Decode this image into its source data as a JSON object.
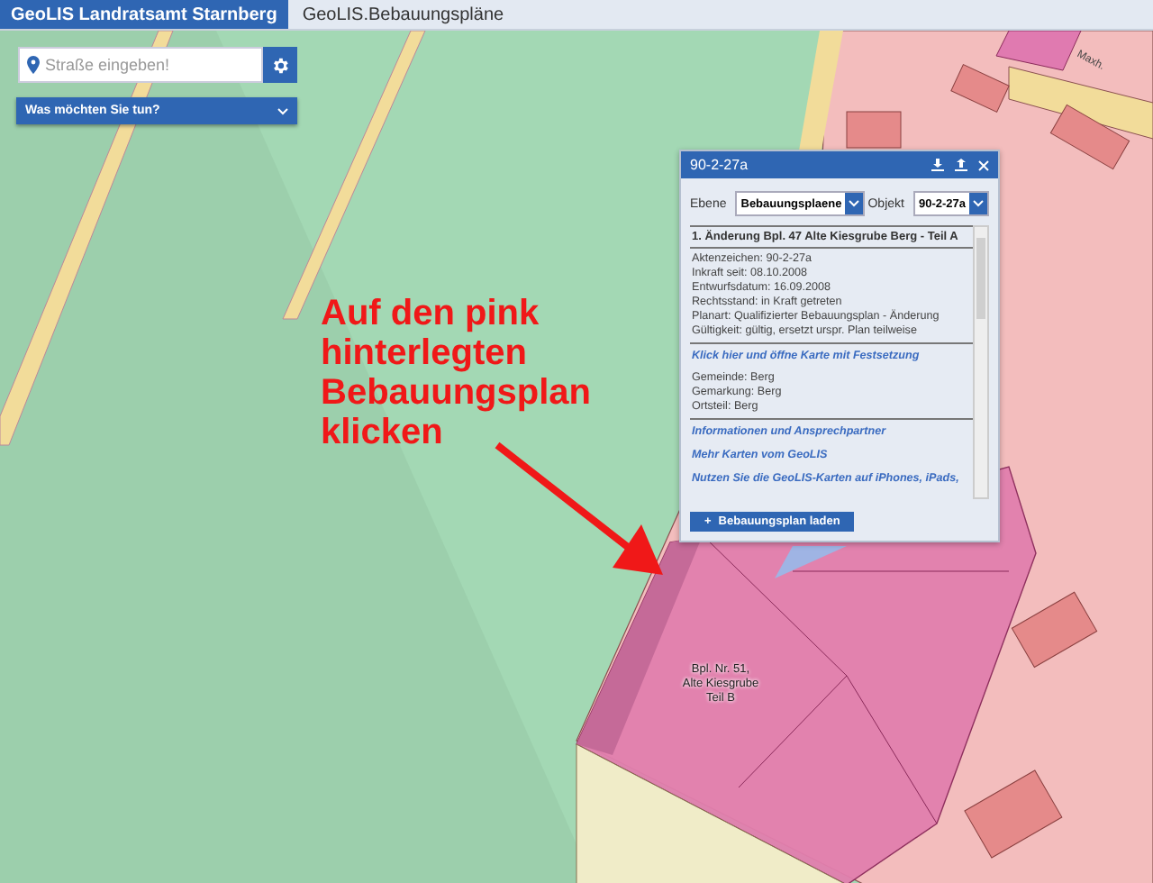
{
  "header": {
    "brand": "GeoLIS Landratsamt Starnberg",
    "title": "GeoLIS.Bebauungspläne"
  },
  "search": {
    "placeholder": "Straße eingeben!"
  },
  "menu": {
    "label": "Was möchten Sie tun?"
  },
  "popup": {
    "title": "90-2-27a",
    "fields": [
      {
        "label": "Ebene",
        "value": "Bebauungsplaene"
      },
      {
        "label": "Objekt",
        "value": "90-2-27a"
      }
    ],
    "sections": [
      {
        "kind": "heading",
        "text": "1. Änderung Bpl. 47 Alte Kiesgrube Berg - Teil A"
      },
      {
        "kind": "lines",
        "lines": [
          "Aktenzeichen: 90-2-27a",
          "Inkraft seit: 08.10.2008",
          "Entwurfsdatum: 16.09.2008",
          "Rechtsstand: in Kraft getreten",
          "Planart: Qualifizierter Bebauungsplan - Änderung",
          "Gültigkeit: gültig, ersetzt urspr. Plan teilweise"
        ]
      },
      {
        "kind": "link",
        "text": "Klick hier und öffne Karte mit Festsetzung"
      },
      {
        "kind": "lines",
        "lines": [
          "Gemeinde: Berg",
          "Gemarkung: Berg",
          "Ortsteil: Berg"
        ]
      },
      {
        "kind": "link",
        "text": "Informationen und Ansprechpartner"
      },
      {
        "kind": "link",
        "text": "Mehr Karten vom GeoLIS"
      },
      {
        "kind": "link",
        "text": "Nutzen Sie die GeoLIS-Karten auf iPhones, iPads,"
      }
    ],
    "button": {
      "icon": "+",
      "label": "Bebauungsplan laden"
    }
  },
  "annotation": {
    "lines": [
      "Auf den pink",
      "hinterlegten",
      "Bebauungsplan",
      "klicken"
    ]
  },
  "map_labels": [
    {
      "kind": "plan",
      "lines": [
        "Bpl. Nr. 51,",
        "Alte Kiesgrube",
        "Teil B"
      ]
    },
    {
      "kind": "street",
      "lines": [
        "Maxh."
      ]
    }
  ]
}
